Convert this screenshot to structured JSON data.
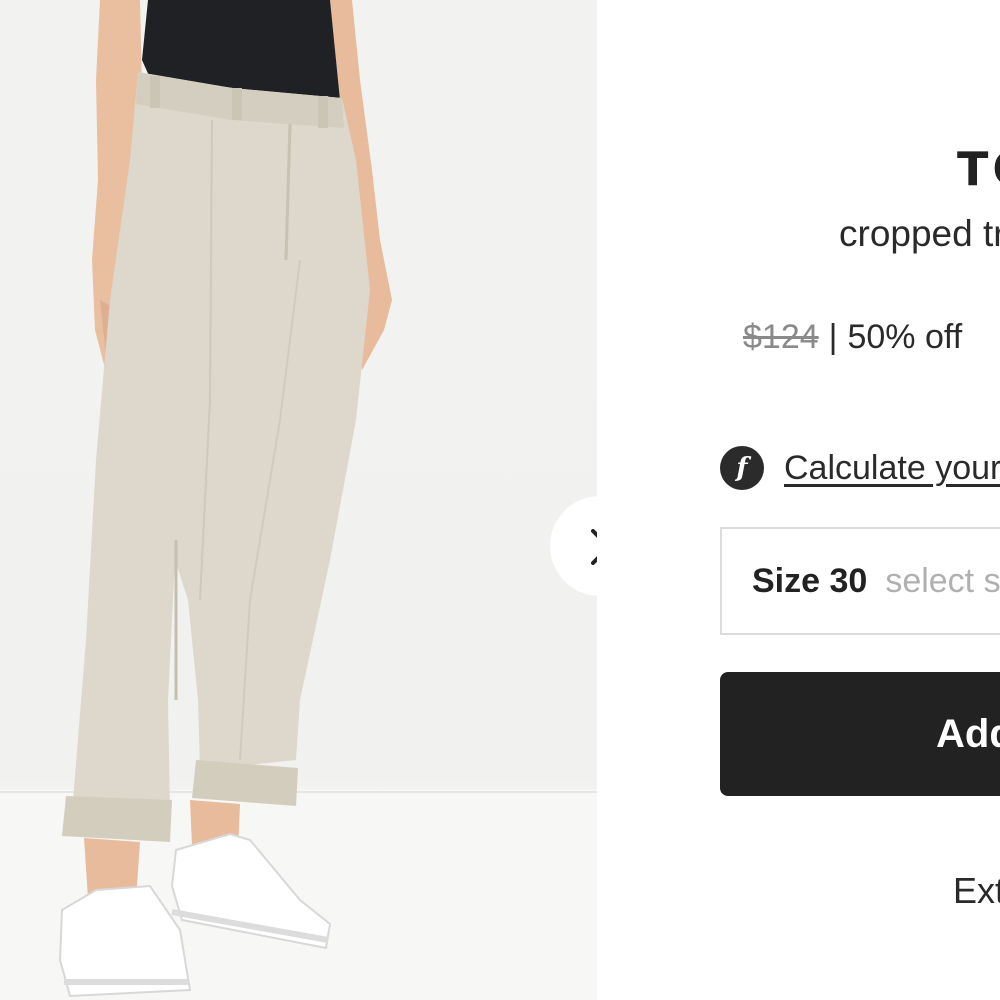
{
  "product": {
    "brand": "TOMMY",
    "name": "cropped trousers",
    "price_original": "$124",
    "price_separator": "|",
    "discount": "50% off"
  },
  "actions": {
    "calculate_icon": "f-circle-icon",
    "calculate_label": "Calculate your size",
    "size_label": "Size 30",
    "size_hint": "select size",
    "add_label": "Add to bag"
  },
  "footer": {
    "text": "Extra"
  },
  "gallery": {
    "next_icon": "chevron-right-icon"
  },
  "colors": {
    "button_bg": "#222222",
    "text": "#2a2a2a",
    "muted": "#8a8a8a",
    "trouser": "#ddd8cb",
    "top": "#1f2125"
  }
}
